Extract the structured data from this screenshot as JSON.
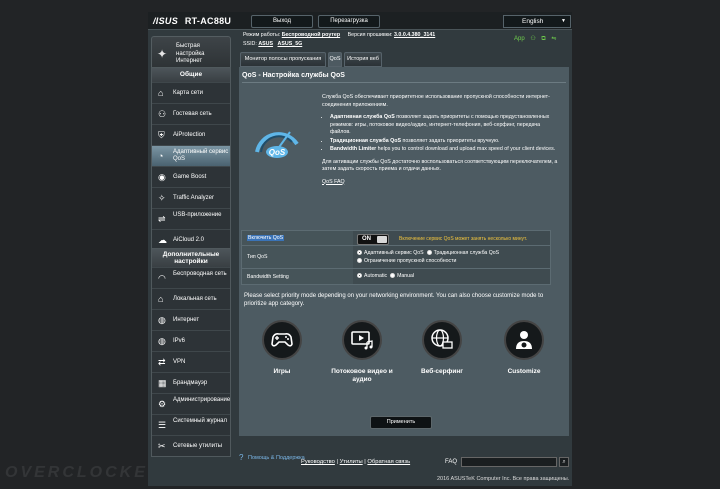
{
  "header": {
    "brand": "/ISUS",
    "model": "RT-AC88U",
    "logout": "Выход",
    "reboot": "Перезагрузка",
    "language": "English"
  },
  "status": {
    "mode_label": "Режим работы:",
    "mode_value": "Беспроводной роутер",
    "firmware_label": "Версия прошивки:",
    "firmware_value": "3.0.0.4.380_3141",
    "ssid_label": "SSID:",
    "ssid_1": "ASUS",
    "ssid_2": "ASUS_5G",
    "app_label": "App"
  },
  "quick_setup": {
    "label": "Быстрая настройка Интернет"
  },
  "sidebar": {
    "general_title": "Общие",
    "general_items": [
      {
        "label": "Карта сети",
        "icon": "map-icon"
      },
      {
        "label": "Гостевая сеть",
        "icon": "guest-icon"
      },
      {
        "label": "AiProtection",
        "icon": "lock-icon"
      },
      {
        "label": "Адаптивный сервис QoS",
        "icon": "qos-icon"
      },
      {
        "label": "Game Boost",
        "icon": "gamepad-icon"
      },
      {
        "label": "Traffic Analyzer",
        "icon": "analyzer-icon"
      },
      {
        "label": "USB-приложение",
        "icon": "usb-icon"
      },
      {
        "label": "AiCloud 2.0",
        "icon": "cloud-icon"
      }
    ],
    "advanced_title": "Дополнительные настройки",
    "advanced_items": [
      {
        "label": "Беспроводная сеть",
        "icon": "wifi-icon"
      },
      {
        "label": "Локальная сеть",
        "icon": "lan-icon"
      },
      {
        "label": "Интернет",
        "icon": "globe-icon"
      },
      {
        "label": "IPv6",
        "icon": "ipv6-icon"
      },
      {
        "label": "VPN",
        "icon": "vpn-icon"
      },
      {
        "label": "Брандмауэр",
        "icon": "firewall-icon"
      },
      {
        "label": "Администрирование",
        "icon": "admin-icon"
      },
      {
        "label": "Системный журнал",
        "icon": "log-icon"
      },
      {
        "label": "Сетевые утилиты",
        "icon": "tools-icon"
      }
    ]
  },
  "tabs": [
    "Монитор полосы пропускания",
    "QoS",
    "История веб"
  ],
  "main": {
    "title": "QoS - Настройка службы QoS",
    "intro": "Служба QoS обеспечивает приоритетное использование пропускной способности интернет-соединения приложениям.",
    "bullets": [
      {
        "bold": "Адаптивная служба QoS",
        "text": " позволяет задать приоритеты с помощью предустановленных режимов: игры, потоковое видео/аудио, интернет-телефония, веб-серфинг, передача файлов."
      },
      {
        "bold": "Традиционная служба QoS",
        "text": " позволяет задать приоритеты вручную."
      },
      {
        "bold": "Bandwidth Limiter",
        "text": " helps you to control download and upload max speed of your client devices."
      }
    ],
    "activation_text": "Для активации службы QoS достаточно воспользоваться соответствующим переключателем, а затем задать скорость приема и отдачи данных.",
    "faq_link": "QoS FAQ",
    "settings": {
      "enable_label": "Включить QoS",
      "enable_state": "ON",
      "enable_warning": "Включение сервис QoS может занять несколько минут.",
      "type_label": "Тип QoS",
      "type_options": [
        "Адаптивный сервис QoS",
        "Традиционная служба QoS",
        "Ограничение пропускной способности"
      ],
      "bw_label": "Bandwidth Setting",
      "bw_options": [
        "Automatic",
        "Manual"
      ]
    },
    "prompt": "Please select priority mode depending on your networking environment. You can also choose customize mode to prioritize app category.",
    "modes": [
      {
        "label": "Игры",
        "icon": "gamepad-icon"
      },
      {
        "label": "Потоковое видео и аудио",
        "icon": "media-icon"
      },
      {
        "label": "Веб-серфинг",
        "icon": "web-icon"
      },
      {
        "label": "Customize",
        "icon": "customize-icon"
      }
    ],
    "apply": "Применить"
  },
  "footer": {
    "help": "Помощь & Поддержка",
    "links": [
      "Руководство",
      "Утилиты",
      "Обратная связь"
    ],
    "faq_label": "FAQ",
    "copyright": "2016 ASUSTeK Computer Inc. Все права защищены."
  },
  "watermark": "OVERCLOCKERS.RU"
}
